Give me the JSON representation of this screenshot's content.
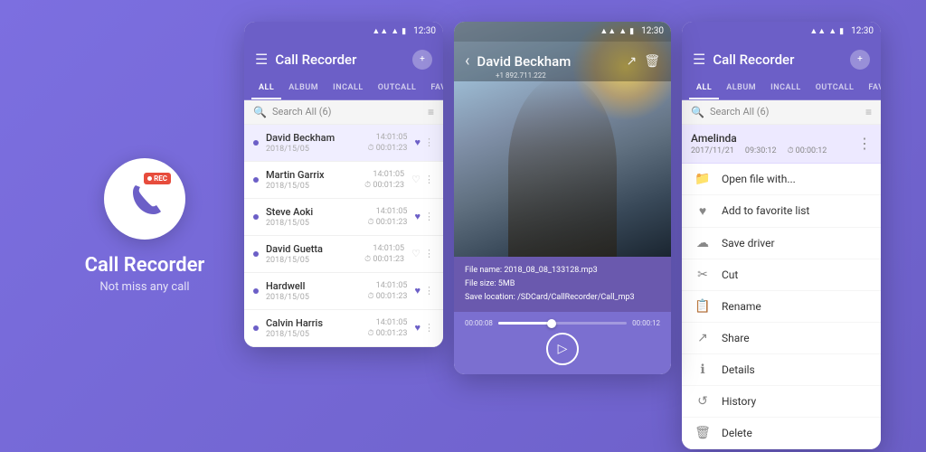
{
  "branding": {
    "title": "Call Recorder",
    "subtitle": "Not miss any call",
    "rec_label": "REC"
  },
  "phone1": {
    "statusBar": {
      "time": "12:30"
    },
    "toolbar": {
      "title": "Call Recorder",
      "menu_icon": "☰"
    },
    "tabs": [
      "ALL",
      "ALBUM",
      "INCALL",
      "OUTCALL",
      "FAVORITE"
    ],
    "activeTab": "ALL",
    "search": {
      "placeholder": "Search All (6)",
      "filter_icon": "≡"
    },
    "calls": [
      {
        "name": "David Beckham",
        "date": "2018/15/05",
        "time": "14:01:05",
        "duration": "00:01:23",
        "favorited": true,
        "active": true
      },
      {
        "name": "Martin Garrix",
        "date": "2018/15/05",
        "time": "14:01:05",
        "duration": "00:01:23",
        "favorited": false,
        "active": false
      },
      {
        "name": "Steve Aoki",
        "date": "2018/15/05",
        "time": "14:01:05",
        "duration": "00:01:23",
        "favorited": true,
        "active": false
      },
      {
        "name": "David Guetta",
        "date": "2018/15/05",
        "time": "14:01:05",
        "duration": "00:01:23",
        "favorited": false,
        "active": false
      },
      {
        "name": "Hardwell",
        "date": "2018/15/05",
        "time": "14:01:05",
        "duration": "00:01:23",
        "favorited": true,
        "active": false
      },
      {
        "name": "Calvin Harris",
        "date": "2018/15/05",
        "time": "14:01:05",
        "duration": "00:01:23",
        "favorited": true,
        "active": false
      }
    ]
  },
  "phone2": {
    "statusBar": {
      "time": "12:30"
    },
    "toolbar": {
      "back": "<",
      "name": "David Beckham",
      "phone": "+1 892.711.222"
    },
    "fileInfo": {
      "name_label": "File name:",
      "name_value": "2018_08_08_133128.mp3",
      "size_label": "File size:",
      "size_value": "5MB",
      "location_label": "Save location:",
      "location_value": "/SDCard/CallRecorder/Call_mp3"
    },
    "player": {
      "start_time": "00:00:08",
      "end_time": "00:00:12",
      "play_icon": "▷"
    }
  },
  "phone3": {
    "statusBar": {
      "time": "12:30"
    },
    "toolbar": {
      "title": "Call Recorder",
      "menu_icon": "☰"
    },
    "tabs": [
      "ALL",
      "ALBUM",
      "INCALL",
      "OUTCALL",
      "FAVORITE"
    ],
    "activeTab": "ALL",
    "search": {
      "placeholder": "Search All (6)"
    },
    "activeCall": {
      "name": "Amelinda",
      "date": "2017/11/21",
      "time": "09:30:12",
      "duration": "00:00:12"
    },
    "contextMenu": [
      {
        "icon": "📁",
        "label": "Open file with..."
      },
      {
        "icon": "♥",
        "label": "Add to favorite list"
      },
      {
        "icon": "☁",
        "label": "Save driver"
      },
      {
        "icon": "✂",
        "label": "Cut"
      },
      {
        "icon": "📋",
        "label": "Rename"
      },
      {
        "icon": "↗",
        "label": "Share"
      },
      {
        "icon": "ℹ",
        "label": "Details"
      },
      {
        "icon": "↺",
        "label": "History"
      },
      {
        "icon": "🗑",
        "label": "Delete"
      }
    ]
  }
}
